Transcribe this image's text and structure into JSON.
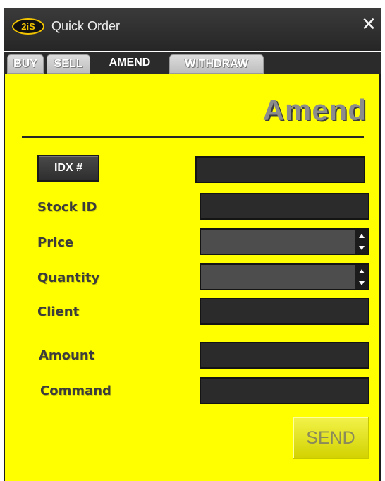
{
  "window": {
    "logo_text": "2iS",
    "title": "Quick Order",
    "close_glyph": "✕",
    "icons": {
      "close": "close-icon",
      "spin_up": "chevron-up-icon",
      "spin_down": "chevron-down-icon"
    }
  },
  "tabs": [
    {
      "label": "BUY",
      "active": false
    },
    {
      "label": "SELL",
      "active": false
    },
    {
      "label": "AMEND",
      "active": true
    },
    {
      "label": "WITHDRAW",
      "active": false
    }
  ],
  "panel": {
    "heading": "Amend",
    "background_color": "#ffff00"
  },
  "form": {
    "idx_button_label": "IDX #",
    "idx_value": "",
    "stock_id_label": "Stock ID",
    "stock_id_value": "",
    "price_label": "Price",
    "price_value": "",
    "quantity_label": "Quantity",
    "quantity_value": "",
    "client_label": "Client",
    "client_value": "",
    "amount_label": "Amount",
    "amount_value": "",
    "command_label": "Command",
    "command_value": ""
  },
  "actions": {
    "send_label": "SEND"
  }
}
